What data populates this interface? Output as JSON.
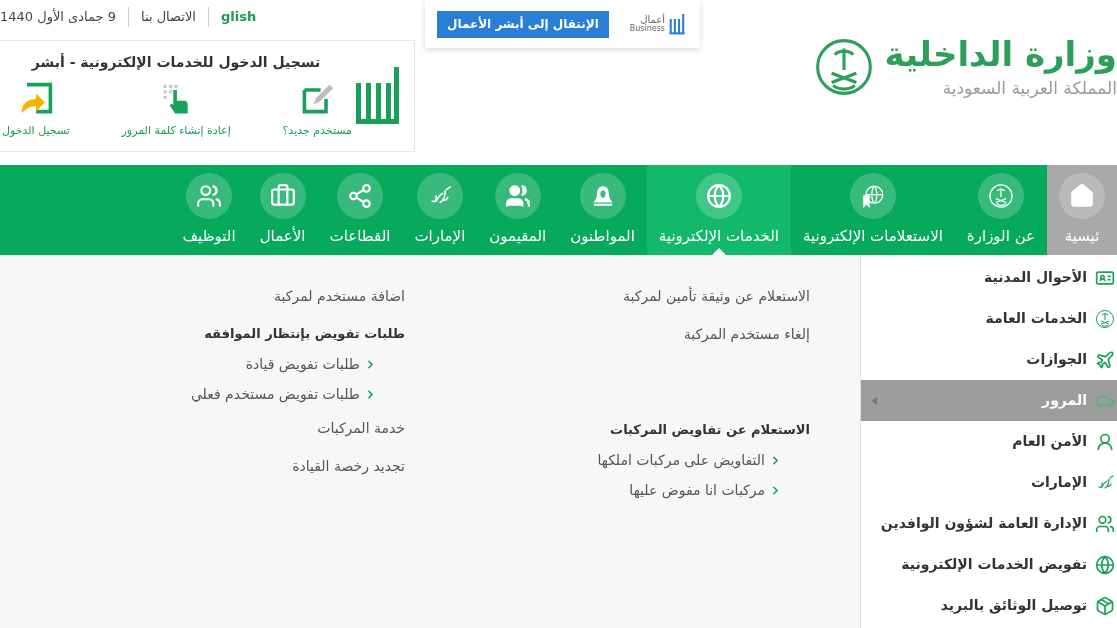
{
  "top_links": [
    {
      "text": "glish",
      "kind": "language"
    },
    {
      "text": "الاتصال بنا",
      "kind": "link"
    },
    {
      "text": "9 جمادى الأول 1440",
      "kind": "date"
    }
  ],
  "login_panel": {
    "title": "تسجيل الدخول للخدمات الإلكترونية - أبشر",
    "actions": [
      {
        "label": "مستخدم جديد؟",
        "kind": "new_user"
      },
      {
        "label": "إعادة إنشاء كلمة المرور",
        "kind": "reset_password"
      },
      {
        "label": "تسجيل الدخول",
        "kind": "login"
      }
    ]
  },
  "business_banner": {
    "logo_text": "أعمال",
    "logo_subtext": "Business",
    "button": "الإنتقال إلى أبشر الأعمال"
  },
  "ministry": {
    "name": "وزارة الداخلية",
    "country": "المملكة العربية السعودية"
  },
  "nav": [
    {
      "label": "ئيسية",
      "kind": "home",
      "selected": false
    },
    {
      "label": "عن الوزارة",
      "kind": "emblem",
      "selected": false
    },
    {
      "label": "الاستعلامات الإلكترونية",
      "kind": "inquiries",
      "selected": false
    },
    {
      "label": "الخدمات الإلكترونية",
      "kind": "globe",
      "selected": true
    },
    {
      "label": "المواطنون",
      "kind": "citizen",
      "selected": false
    },
    {
      "label": "المقيمون",
      "kind": "residents",
      "selected": false
    },
    {
      "label": "الإمارات",
      "kind": "calligraphy",
      "selected": false
    },
    {
      "label": "القطاعات",
      "kind": "network",
      "selected": false
    },
    {
      "label": "الأعمال",
      "kind": "briefcase",
      "selected": false
    },
    {
      "label": "التوظيف",
      "kind": "team",
      "selected": false
    }
  ],
  "sidebar": [
    {
      "label": "الأحوال المدنية",
      "kind": "id_card",
      "selected": false
    },
    {
      "label": "الخدمات العامة",
      "kind": "globe_badge",
      "selected": false
    },
    {
      "label": "الجوازات",
      "kind": "plane",
      "selected": false
    },
    {
      "label": "المرور",
      "kind": "traffic",
      "selected": true
    },
    {
      "label": "الأمن العام",
      "kind": "officer",
      "selected": false
    },
    {
      "label": "الإمارات",
      "kind": "calligraphy",
      "selected": false
    },
    {
      "label": "الإدارة العامة لشؤون الوافدين",
      "kind": "people",
      "selected": false
    },
    {
      "label": "تفويض الخدمات الإلكترونية",
      "kind": "globe",
      "selected": false
    },
    {
      "label": "توصيل الوثائق بالبريد",
      "kind": "package",
      "selected": false
    }
  ],
  "menu_columns": [
    [
      {
        "text": "الاستعلام عن وثيقة تأمين لمركبة",
        "kind": "link"
      },
      {
        "text": "إلغاء مستخدم المركبة",
        "kind": "link"
      },
      {
        "text": "الاستعلام عن تفاويض المركبات",
        "kind": "heading"
      },
      {
        "text": "التفاويض على مركبات املكها",
        "kind": "sub_link"
      },
      {
        "text": "مركبات انا مفوض عليها",
        "kind": "sub_link"
      }
    ],
    [
      {
        "text": "اضافة مستخدم لمركبة",
        "kind": "link"
      },
      {
        "text": "طلبات تفويض بإنتظار الموافقه",
        "kind": "heading"
      },
      {
        "text": "طلبات تفويض قيادة",
        "kind": "sub_link"
      },
      {
        "text": "طلبات تفويض مستخدم فعلي",
        "kind": "sub_link"
      },
      {
        "text": "خدمة المركبات",
        "kind": "link"
      },
      {
        "text": "تجديد رخصة القيادة",
        "kind": "link"
      }
    ]
  ]
}
